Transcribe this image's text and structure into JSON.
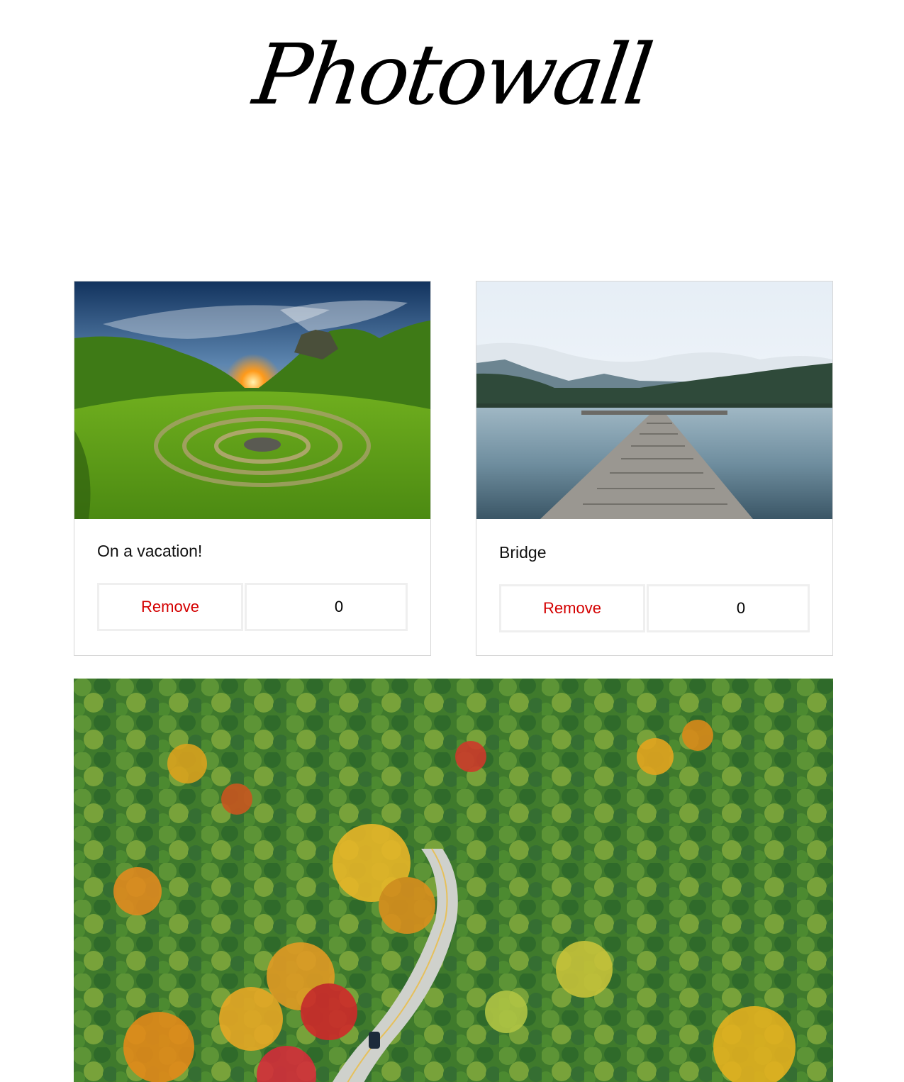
{
  "header": {
    "title": "Photowall"
  },
  "posts": [
    {
      "caption": "On a vacation!",
      "remove_label": "Remove",
      "likes": "0"
    },
    {
      "caption": "Bridge",
      "remove_label": "Remove",
      "likes": "0"
    },
    {}
  ]
}
